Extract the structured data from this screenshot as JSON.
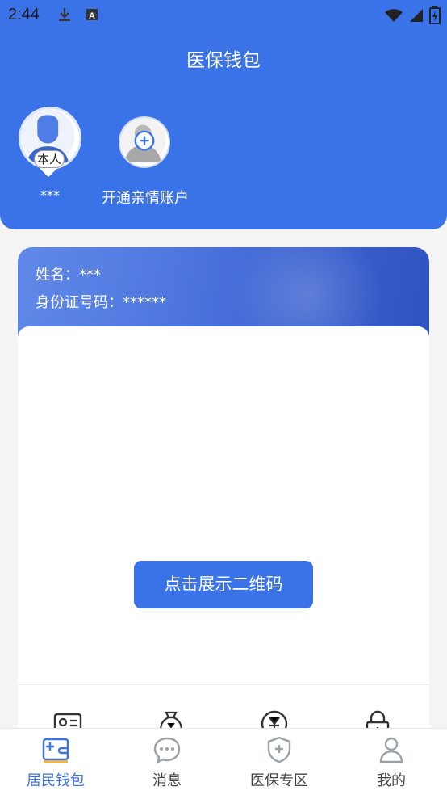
{
  "status_bar": {
    "time": "2:44",
    "icons": [
      "download-icon",
      "a-notification-icon",
      "wifi-icon",
      "signal-icon",
      "battery-charging-icon"
    ]
  },
  "header": {
    "title": "医保钱包"
  },
  "profiles": {
    "self": {
      "tag": "本人",
      "name": "***",
      "icon": "user-avatar-icon"
    },
    "add": {
      "label": "开通亲情账户",
      "icon": "add-family-icon"
    }
  },
  "card": {
    "name_line": "姓名：***",
    "id_line": "身份证号码：******",
    "qr_button": "点击展示二维码",
    "quick_icons": [
      "id-card-icon",
      "money-bag-icon",
      "yuan-coin-icon",
      "lock-icon"
    ]
  },
  "tabs": [
    {
      "label": "居民钱包",
      "icon": "wallet-icon",
      "active": true
    },
    {
      "label": "消息",
      "icon": "message-icon",
      "active": false
    },
    {
      "label": "医保专区",
      "icon": "shield-icon",
      "active": false
    },
    {
      "label": "我的",
      "icon": "person-icon",
      "active": false
    }
  ],
  "colors": {
    "primary": "#3a72e8",
    "background": "#f4f4f4"
  }
}
